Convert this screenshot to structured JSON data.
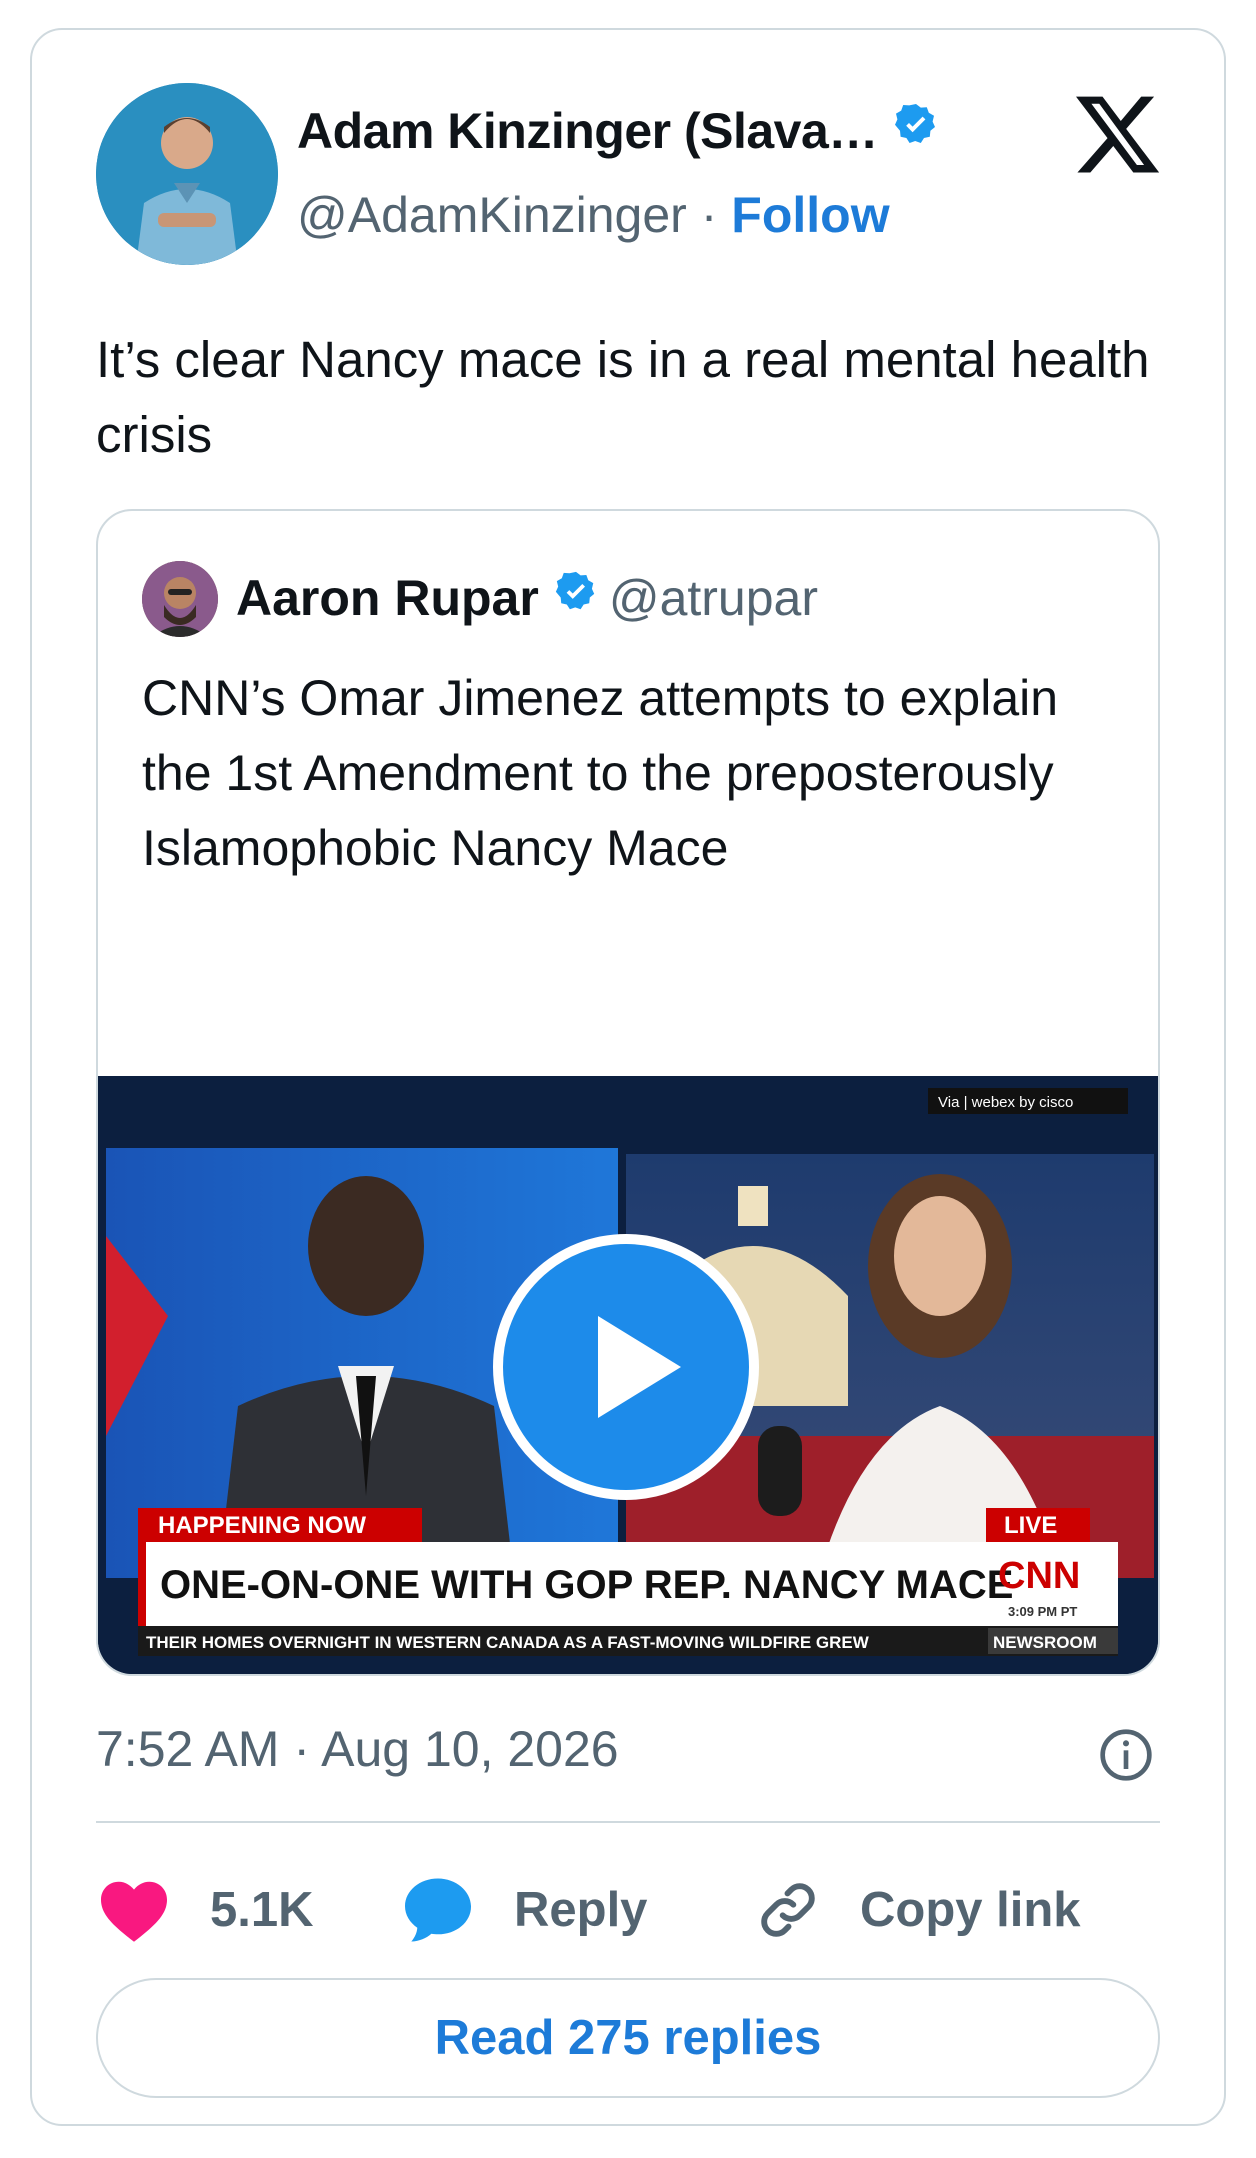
{
  "author": {
    "name": "Adam Kinzinger (Slava…",
    "handle": "@AdamKinzinger",
    "separator": "·",
    "follow_label": "Follow"
  },
  "tweet": {
    "text": "It’s clear Nancy mace is in a real mental health crisis",
    "timestamp": "7:52 AM · Aug 10, 2026"
  },
  "quoted": {
    "name": "Aaron Rupar",
    "handle": "@atrupar",
    "text": "CNN’s Omar Jimenez attempts to explain the 1st Amendment to the preposterously Islamophobic Nancy Mace"
  },
  "video": {
    "via_label": "Via | webex by cisco",
    "happening_label": "HAPPENING NOW",
    "live_label": "LIVE",
    "headline": "ONE-ON-ONE WITH GOP REP. NANCY MACE",
    "network": "CNN",
    "time": "3:09 PM PT",
    "ticker": "THEIR HOMES OVERNIGHT IN WESTERN CANADA AS A FAST-MOVING WILDFIRE GREW",
    "show": "NEWSROOM"
  },
  "actions": {
    "likes": "5.1K",
    "reply_label": "Reply",
    "copy_label": "Copy link",
    "read_replies_label": "Read 275 replies"
  },
  "colors": {
    "accent": "#1d7bd8",
    "heart": "#f91880",
    "verified": "#1d9bf0",
    "muted": "#536471",
    "border": "#cfd9de"
  },
  "icons": [
    "verified-badge-icon",
    "x-logo-icon",
    "play-icon",
    "info-icon",
    "heart-icon",
    "reply-bubble-icon",
    "link-icon"
  ]
}
